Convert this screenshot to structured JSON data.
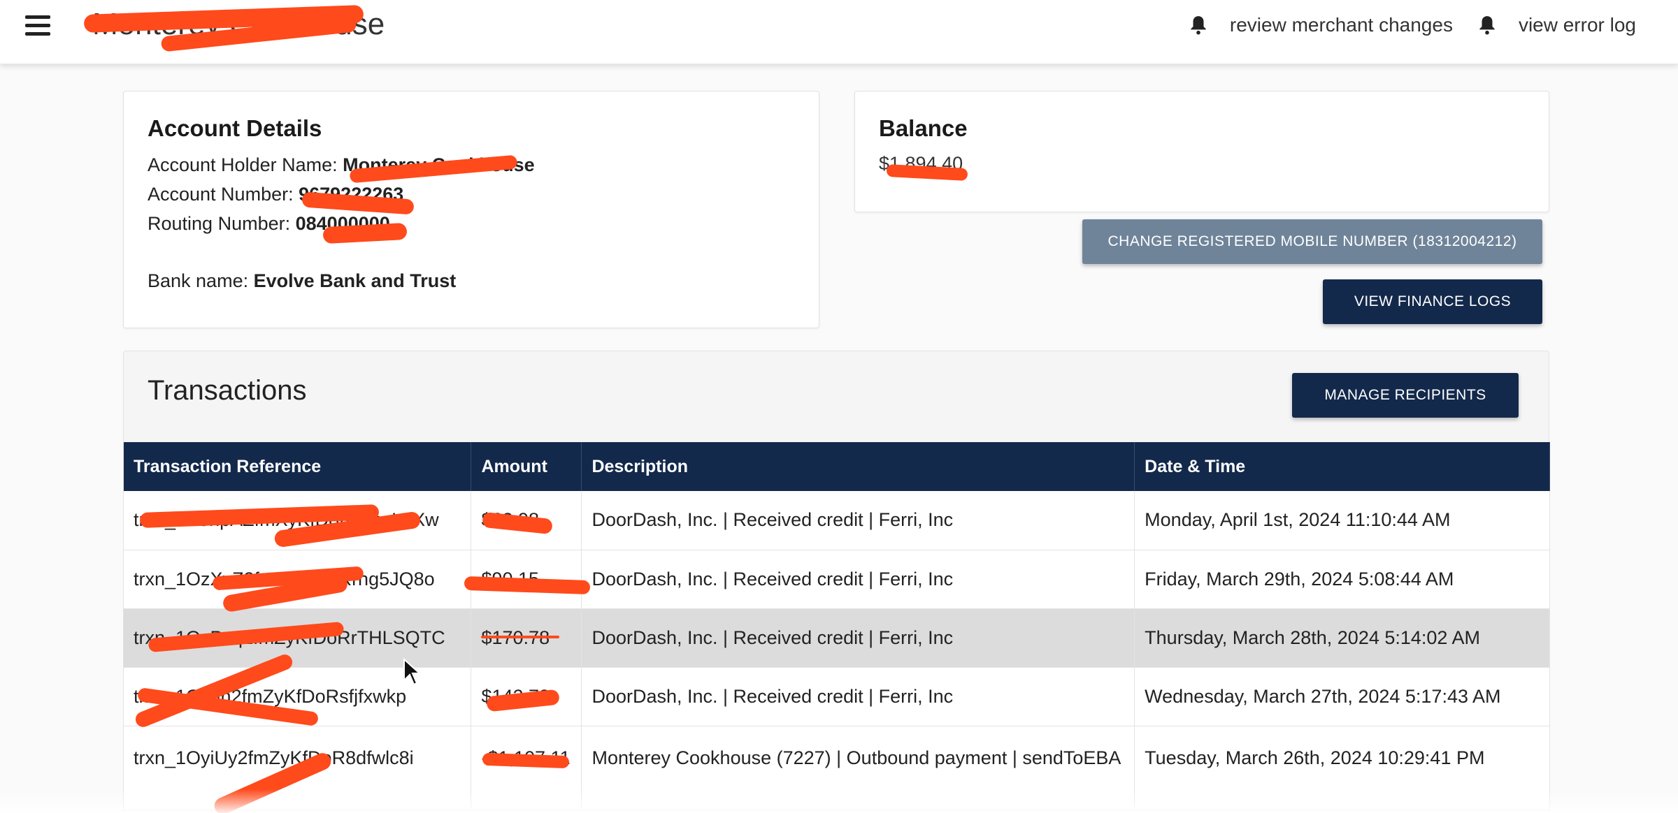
{
  "header": {
    "menu_icon": "hamburger-icon",
    "app_title": "Monterey Cookhouse",
    "links": [
      {
        "label": "review merchant changes",
        "icon": "bell-icon"
      },
      {
        "label": "view error log",
        "icon": "bell-icon"
      }
    ]
  },
  "account": {
    "heading": "Account Details",
    "holder_label": "Account Holder Name:",
    "holder_value": "Monterey Cookhouse",
    "number_label": "Account Number:",
    "number_value": "9679222263",
    "routing_label": "Routing Number:",
    "routing_value": "084000000",
    "bank_label": "Bank name:",
    "bank_value": "Evolve Bank and Trust"
  },
  "balance": {
    "heading": "Balance",
    "value": "$1,894.40"
  },
  "buttons": {
    "change_mobile": "CHANGE REGISTERED MOBILE NUMBER (18312004212)",
    "view_logs": "VIEW FINANCE LOGS",
    "manage_recipients": "MANAGE RECIPIENTS"
  },
  "transactions": {
    "title": "Transactions",
    "columns": [
      "Transaction Reference",
      "Amount",
      "Description",
      "Date & Time"
    ],
    "rows": [
      {
        "ref": "trxn_1P0npAZfmXyKfDoRGjpvL7Xw",
        "amount": "$63.98",
        "description": "DoorDash, Inc. | Received credit | Ferri, Inc",
        "datetime": "Monday, April 1st, 2024 11:10:44 AM"
      },
      {
        "ref": "trxn_1OzXyZ2fmZyKfDoRrhg5JQ8o",
        "amount": "$90.15",
        "description": "DoorDash, Inc. | Received credit | Ferri, Inc",
        "datetime": "Friday, March 29th, 2024 5:08:44 AM"
      },
      {
        "ref": "trxn_1OzPxq2fmZyKfDoRrTHLSQTC",
        "amount": "$170.78",
        "description": "DoorDash, Inc. | Received credit | Ferri, Inc",
        "datetime": "Thursday, March 28th, 2024 5:14:02 AM"
      },
      {
        "ref": "trxn_1Oyun2fmZyKfDoRsfjfxwkp",
        "amount": "$142.73",
        "description": "DoorDash, Inc. | Received credit | Ferri, Inc",
        "datetime": "Wednesday, March 27th, 2024 5:17:43 AM"
      },
      {
        "ref": "trxn_1OyiUy2fmZyKfDoR8dfwlc8i",
        "amount": "-$1,107.11",
        "description": "Monterey Cookhouse (7227) | Outbound payment | sendToEBA",
        "datetime": "Tuesday, March 26th, 2024 10:29:41 PM"
      }
    ]
  },
  "colors": {
    "navy": "#13294b",
    "slate": "#6f8499",
    "redaction": "#ff4a1c"
  }
}
